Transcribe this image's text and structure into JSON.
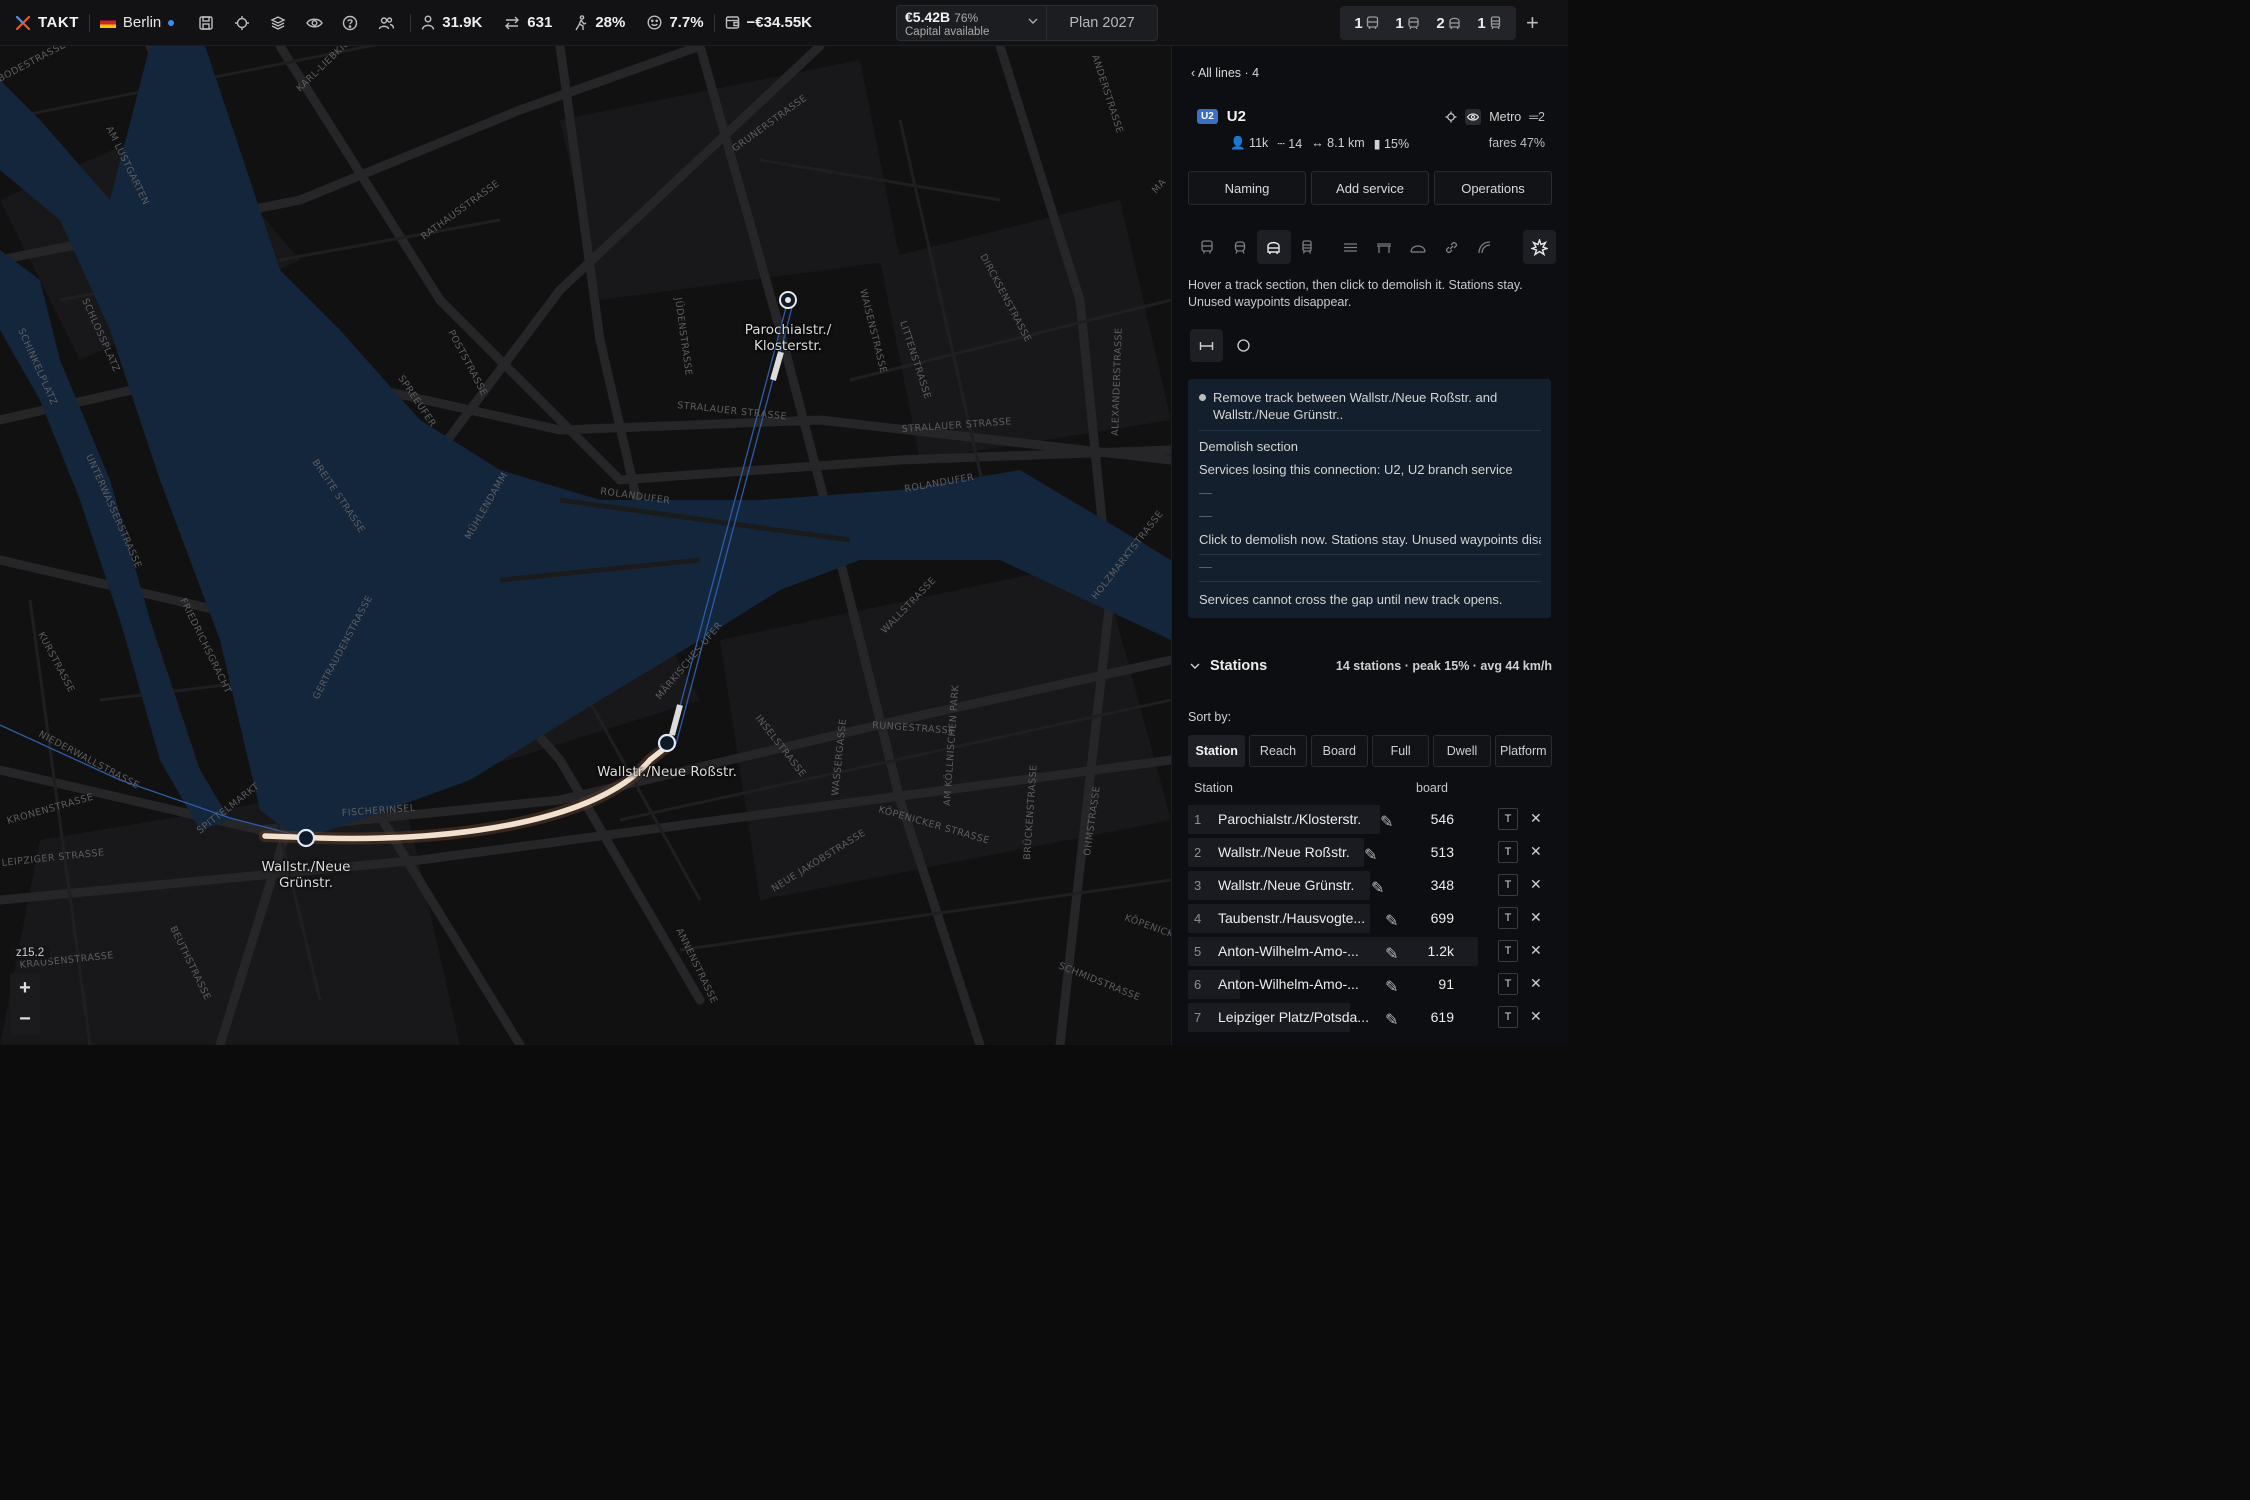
{
  "topbar": {
    "app_name": "TAKT",
    "city": "Berlin",
    "stats": {
      "population": "31.9K",
      "transfers": "631",
      "walk_share": "28%",
      "happiness": "7.7%",
      "balance": "−€34.55K"
    },
    "capital": {
      "amount": "€5.42B",
      "percent": "76%",
      "label": "Capital available"
    },
    "plan": "Plan 2027",
    "vehicle_counts": [
      "1",
      "1",
      "2",
      "1"
    ]
  },
  "map": {
    "zoom": "z15.2",
    "zoom_in": "+",
    "zoom_out": "−",
    "station_labels": {
      "parochial": "Parochialstr./\nKlosterstr.",
      "rossstr": "Wallstr./Neue Roßstr.",
      "gruenstr": "Wallstr./Neue\nGrünstr."
    },
    "street_labels": [
      "STRALAUER STRASSE",
      "ROLANDUFER",
      "MÜHLENDAMM",
      "BREITE STRASSE",
      "SPREEUFER",
      "POSTSTRASSE",
      "RATHAUSSTRASSE",
      "GRUNERSTRASSE",
      "LITTENSTRASSE",
      "WAISENSTRASSE",
      "JÜDENSTRASSE",
      "DIRCKSENSTRASSE",
      "ALEXANDERSTRASSE",
      "WALLSTRASSE",
      "MÄRKISCHES UFER",
      "INSELSTRASSE",
      "RUNGESTRASSE",
      "KÖPENICKER STRASSE",
      "FISCHERINSEL",
      "LEIPZIGER STRASSE",
      "NIEDERWALLSTRASSE",
      "SPITTELMARKT",
      "KRONENSTRASSE",
      "FRIEDRICHSGRACHT",
      "GERTRAUDENSTRASSE",
      "BRÜCKENSTRASSE",
      "AM KÖLLNISCHEN PARK",
      "WASSERGASSE",
      "NEUE JAKOBSTRASSE",
      "SCHMIDSTRASSE",
      "ANNENSTRASSE",
      "OHMSTRASSE",
      "KURSTRASSE",
      "SCHLOSSPLATZ",
      "SCHINKELPLATZ",
      "UNTERWASSERSTRASSE",
      "AM LUSTGARTEN",
      "KARL-LIEBKNECHT",
      "BODESTRASSE",
      "BEUTHSTRASSE",
      "KRAUSENSTRASSE",
      "KÖPENICK",
      "ANDERSTRASSE",
      "HOLZMARKTSTRASSE",
      "MA"
    ]
  },
  "panel": {
    "back_label": "‹ All lines · 4",
    "line": {
      "badge": "U2",
      "name": "U2",
      "type": "Metro",
      "count": "2",
      "riders": "11k",
      "stations": "14",
      "length": "8.1 km",
      "load": "15%",
      "fares": "fares 47%"
    },
    "tabs": [
      "Naming",
      "Add service",
      "Operations"
    ],
    "hint": "Hover a track section, then click to demolish it. Stations stay. Unused waypoints disappear.",
    "info": {
      "headline": "Remove track between Wallstr./Neue Roßstr. and Wallstr./Neue Grünstr..",
      "title": "Demolish section",
      "services_losing": "Services losing this connection: U2, U2 branch service",
      "dash1": "—",
      "dash2": "—",
      "click_note": "Click to demolish now. Stations stay. Unused waypoints disappear.",
      "dash3": "—",
      "gap_note": "Services cannot cross the gap until new track opens."
    },
    "stations_section": {
      "title": "Stations",
      "meta": "14 stations · peak 15% · avg 44 km/h",
      "sort_label": "Sort by:",
      "sort_options": [
        "Station",
        "Reach",
        "Board",
        "Full",
        "Dwell",
        "Platform"
      ],
      "col_station": "Station",
      "col_board": "board",
      "rows": [
        {
          "n": "1",
          "name": "Parochialstr./Klosterstr.",
          "board": "546",
          "t": "T"
        },
        {
          "n": "2",
          "name": "Wallstr./Neue Roßstr.",
          "board": "513",
          "t": "T"
        },
        {
          "n": "3",
          "name": "Wallstr./Neue Grünstr.",
          "board": "348",
          "t": "T"
        },
        {
          "n": "4",
          "name": "Taubenstr./Hausvogte...",
          "board": "699",
          "t": "T"
        },
        {
          "n": "5",
          "name": "Anton-Wilhelm-Amo-...",
          "board": "1.2k",
          "t": "T"
        },
        {
          "n": "6",
          "name": "Anton-Wilhelm-Amo-...",
          "board": "91",
          "t": "T"
        },
        {
          "n": "7",
          "name": "Leipziger Platz/Potsda...",
          "board": "619",
          "t": "T"
        }
      ]
    }
  }
}
